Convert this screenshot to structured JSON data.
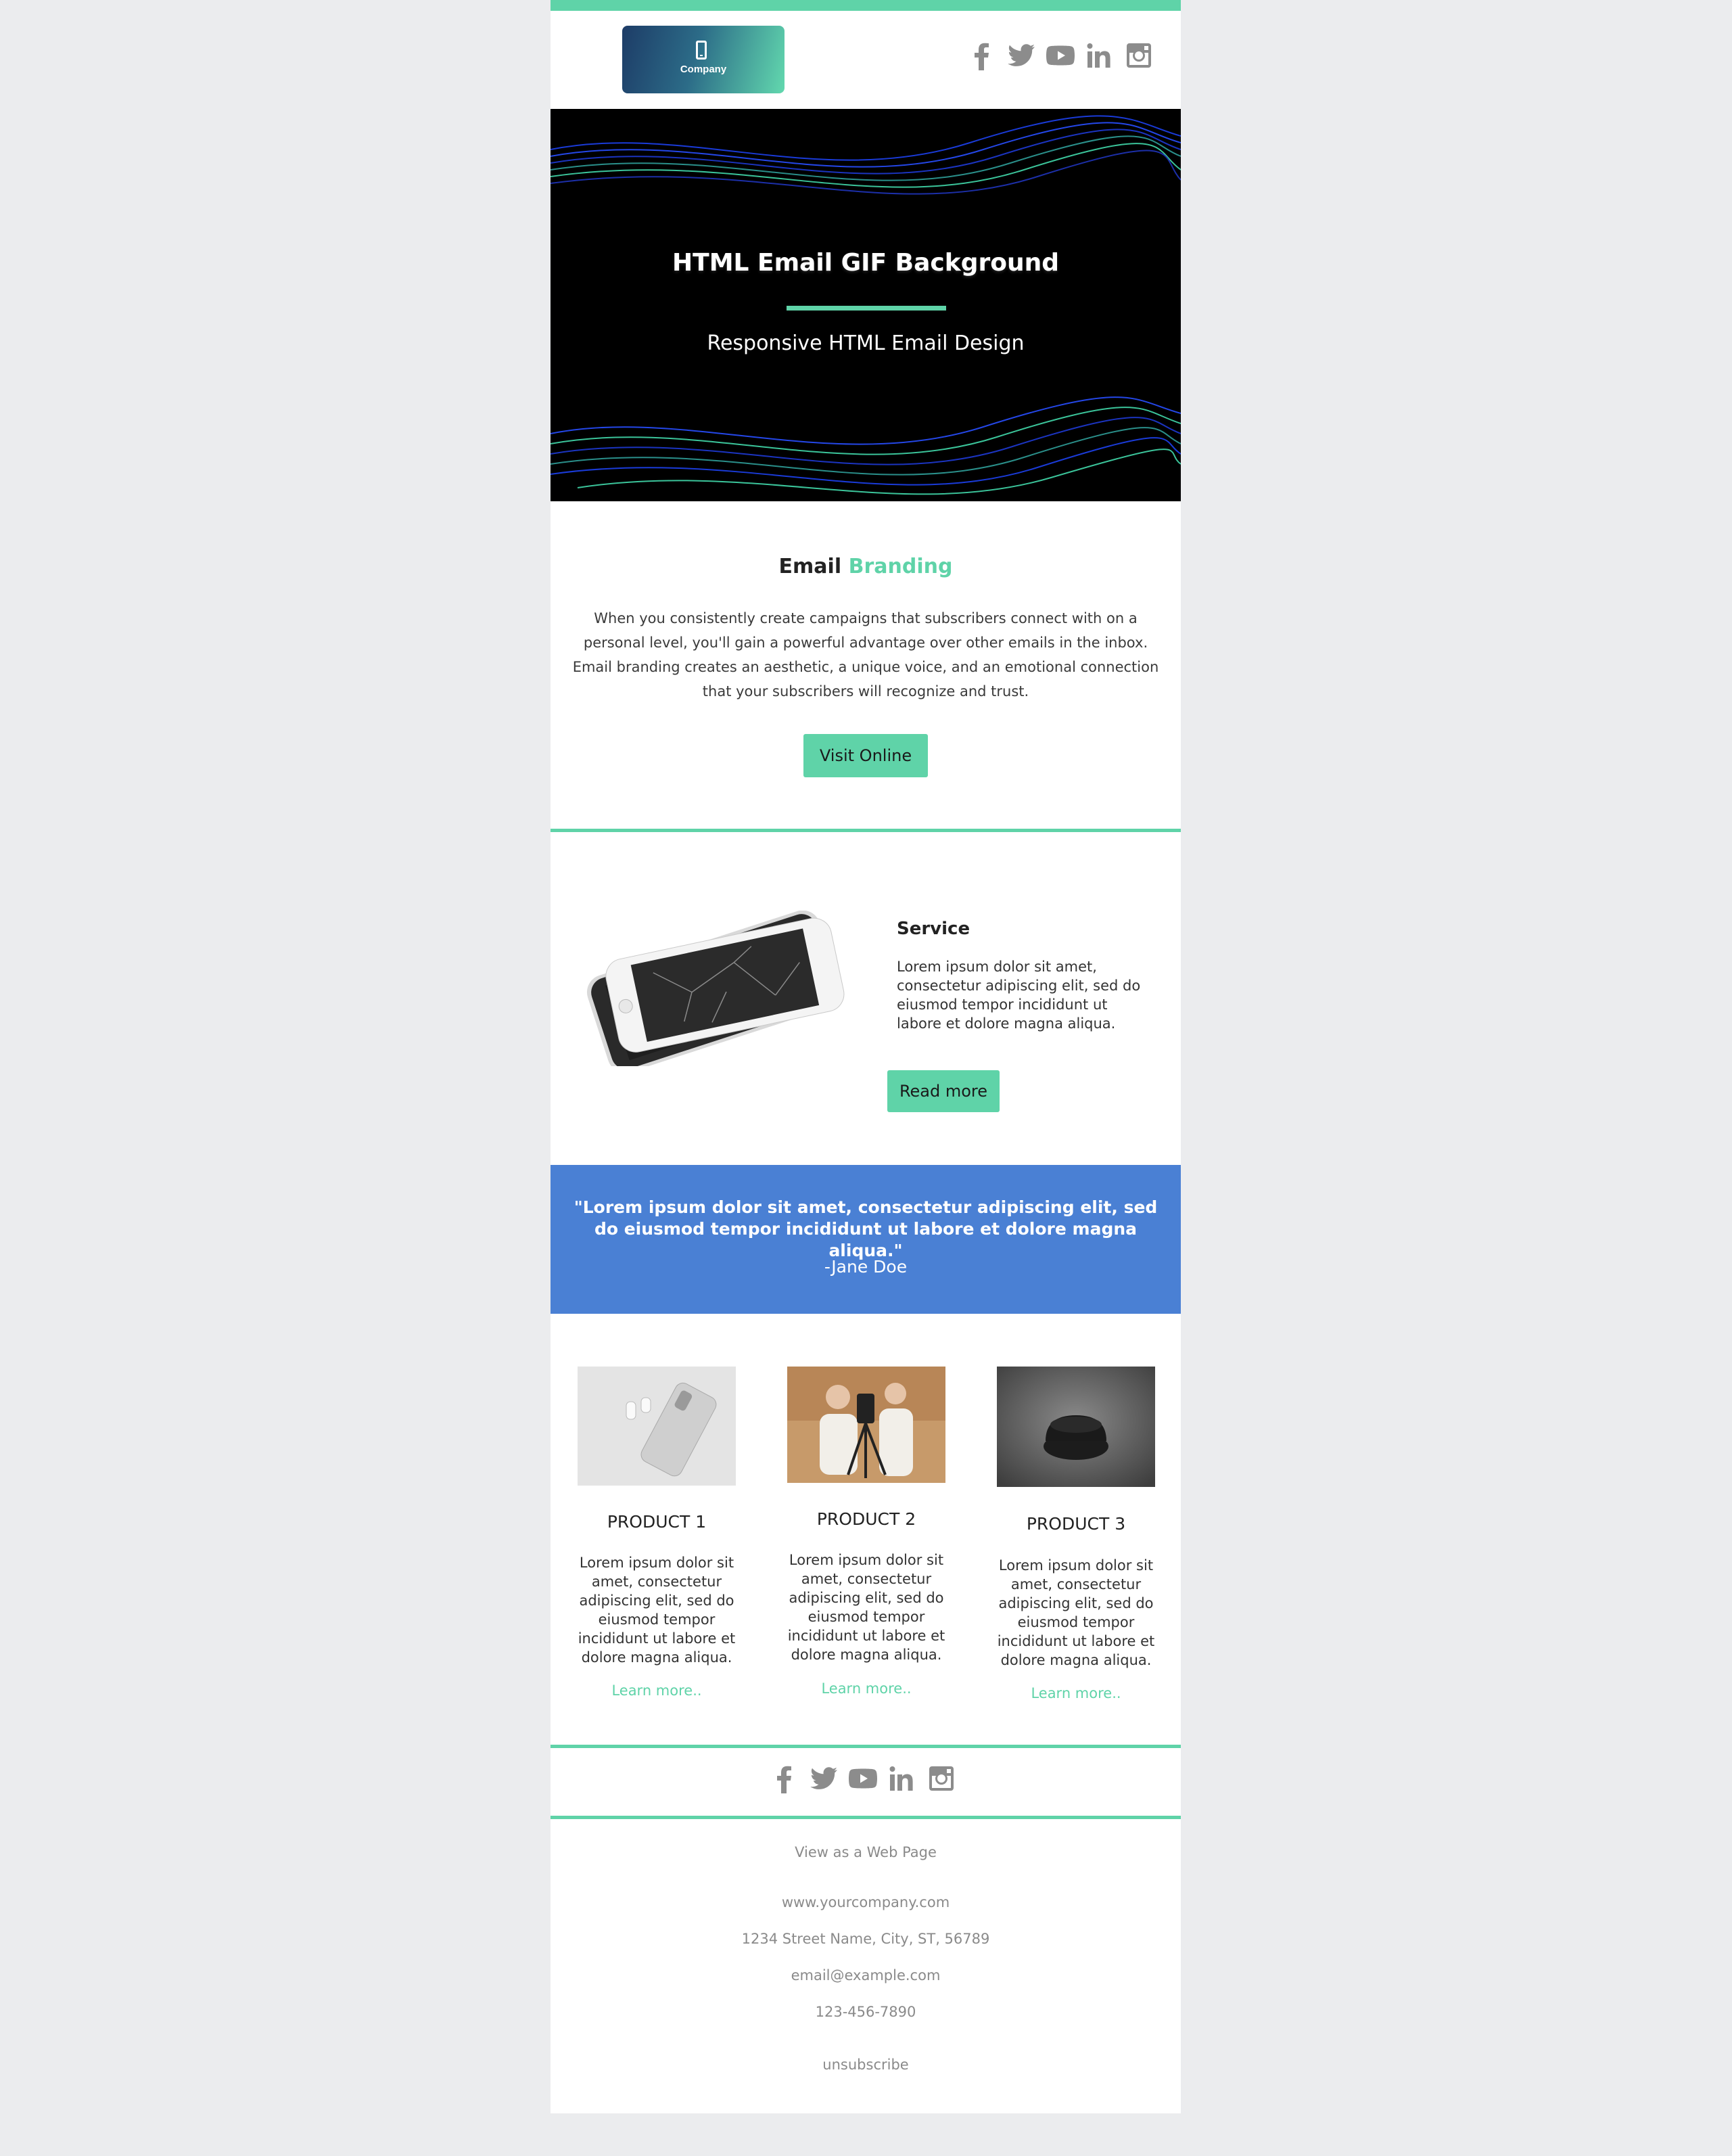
{
  "header": {
    "logo_text": "Company",
    "social": [
      "facebook-icon",
      "twitter-icon",
      "youtube-icon",
      "linkedin-icon",
      "instagram-icon"
    ]
  },
  "hero": {
    "title": "HTML Email GIF Background",
    "subtitle": "Responsive HTML Email Design"
  },
  "branding": {
    "title_main": "Email",
    "title_accent": "Branding",
    "body": "When you consistently create campaigns that subscribers connect with on a personal level, you'll gain a powerful advantage over other emails in the inbox. Email branding creates an aesthetic, a unique voice, and an emotional connection that your subscribers will recognize and trust.",
    "button": "Visit Online"
  },
  "service": {
    "title": "Service",
    "body": "Lorem ipsum dolor sit amet, consectetur adipiscing elit, sed do eiusmod tempor incididunt ut labore et dolore magna aliqua.",
    "button": "Read more"
  },
  "testimonial": {
    "quote": "\"Lorem ipsum dolor sit amet, consectetur adipiscing elit, sed do eiusmod tempor incididunt ut labore et dolore magna aliqua.\"",
    "author": "-Jane Doe"
  },
  "products": [
    {
      "title": "PRODUCT 1",
      "body": "Lorem ipsum dolor sit amet, consectetur adipiscing elit, sed do eiusmod tempor incididunt ut labore et dolore magna aliqua.",
      "link": "Learn more.."
    },
    {
      "title": "PRODUCT 2",
      "body": "Lorem ipsum dolor sit amet, consectetur adipiscing elit, sed do eiusmod tempor incididunt ut labore et dolore magna aliqua.",
      "link": "Learn more.."
    },
    {
      "title": "PRODUCT 3",
      "body": "Lorem ipsum dolor sit amet, consectetur adipiscing elit, sed do eiusmod tempor incididunt ut labore et dolore magna aliqua.",
      "link": "Learn more.."
    }
  ],
  "footer": {
    "view_web": "View as a Web Page",
    "website": "www.yourcompany.com",
    "address": "1234 Street Name, City, ST, 56789",
    "email": "email@example.com",
    "phone": "123-456-7890",
    "unsubscribe": "unsubscribe"
  },
  "colors": {
    "accent": "#5fd3a8",
    "quote_bg": "#4a80d4",
    "page_bg": "#ebecee",
    "hero_bg": "#000000"
  }
}
